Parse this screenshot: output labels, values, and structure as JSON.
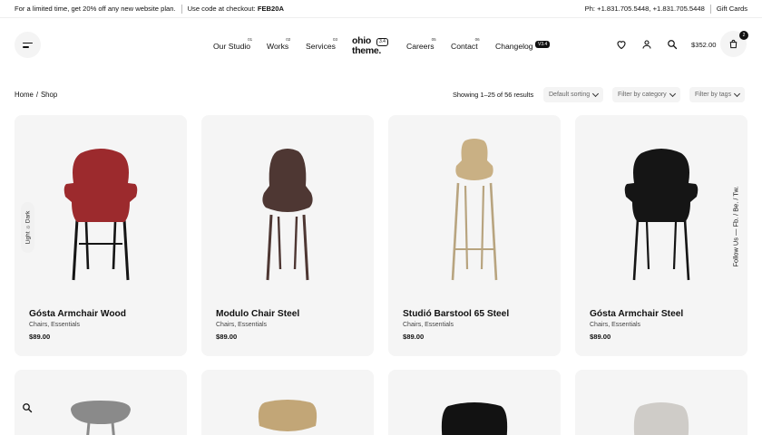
{
  "topbar": {
    "promo": "For a limited time, get 20% off any new website plan.",
    "code_prefix": "Use code at checkout: ",
    "code": "FEB20A",
    "phone": "Ph: +1.831.705.5448, +1.831.705.5448",
    "gift_cards": "Gift Cards"
  },
  "nav": {
    "items": [
      {
        "label": "Our Studio",
        "num": "01"
      },
      {
        "label": "Works",
        "num": "02"
      },
      {
        "label": "Services",
        "num": "03"
      },
      {
        "label": "Careers",
        "num": "05"
      },
      {
        "label": "Contact",
        "num": "06"
      },
      {
        "label": "Changelog",
        "badge": "V3.4"
      }
    ],
    "logo_line1": "ohio",
    "logo_line2": "theme.",
    "logo_version": "3.4"
  },
  "header": {
    "cart_total": "$352.00",
    "cart_count": "2",
    "icons": [
      "menu-icon",
      "heart-icon",
      "user-icon",
      "search-icon",
      "bag-icon"
    ]
  },
  "breadcrumb": {
    "home": "Home",
    "sep": "/",
    "current": "Shop"
  },
  "toolbar": {
    "results": "Showing 1–25 of 56 results",
    "sorting": "Default sorting",
    "category": "Filter by category",
    "tags": "Filter by tags"
  },
  "products": [
    {
      "name": "Gósta Armchair Wood",
      "categories": "Chairs, Essentials",
      "price": "$89.00",
      "color": "#9c2a2d"
    },
    {
      "name": "Modulo Chair Steel",
      "categories": "Chairs, Essentials",
      "price": "$89.00",
      "color": "#4e3733"
    },
    {
      "name": "Studió Barstool 65 Steel",
      "categories": "Chairs, Essentials",
      "price": "$89.00",
      "color": "#c9b084"
    },
    {
      "name": "Gósta Armchair Steel",
      "categories": "Chairs, Essentials",
      "price": "$89.00",
      "color": "#151515"
    }
  ],
  "products_row2_colors": [
    "#8a8a8a",
    "#c2a677",
    "#121212",
    "#cfccc8"
  ],
  "side": {
    "theme_toggle": "Light ☼ Dark",
    "follow": "Follow Us — Fb. / Be. / Tw."
  }
}
